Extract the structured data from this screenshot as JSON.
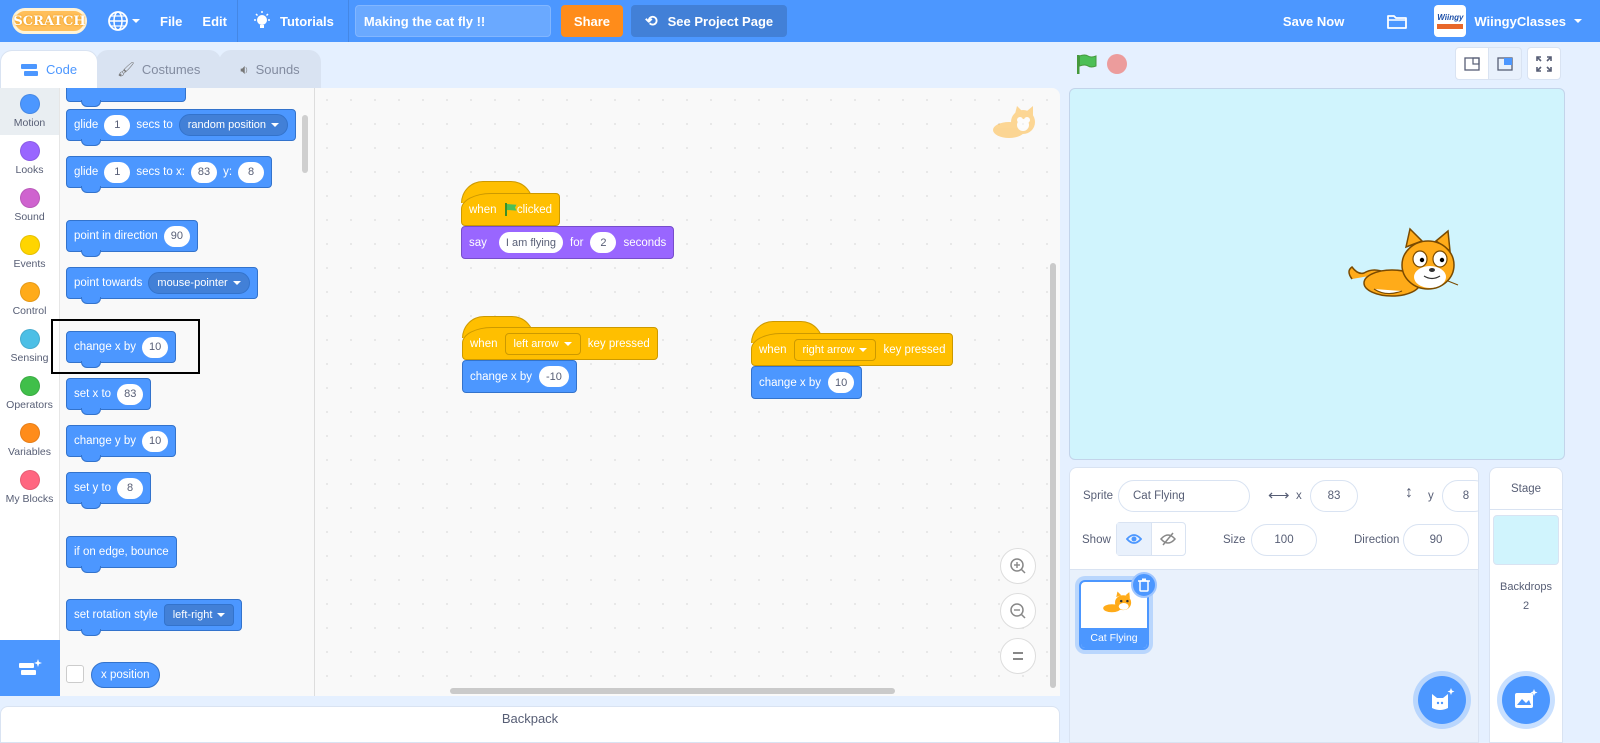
{
  "menubar": {
    "logo": "SCRATCH",
    "file": "File",
    "edit": "Edit",
    "tutorials": "Tutorials",
    "project_title": "Making the cat fly !!",
    "share": "Share",
    "see_project_page": "See Project Page",
    "save_now": "Save Now",
    "username": "WiingyClasses",
    "avatar_text": "Wiingy"
  },
  "tabs": [
    {
      "label": "Code",
      "active": true
    },
    {
      "label": "Costumes",
      "active": false
    },
    {
      "label": "Sounds",
      "active": false
    }
  ],
  "categories": [
    {
      "label": "Motion",
      "color": "#4c97ff"
    },
    {
      "label": "Looks",
      "color": "#9966ff"
    },
    {
      "label": "Sound",
      "color": "#cf63cf"
    },
    {
      "label": "Events",
      "color": "#ffbf00"
    },
    {
      "label": "Control",
      "color": "#ffab19"
    },
    {
      "label": "Sensing",
      "color": "#5cb1d6"
    },
    {
      "label": "Operators",
      "color": "#59c059"
    },
    {
      "label": "Variables",
      "color": "#ff8c1a"
    },
    {
      "label": "My Blocks",
      "color": "#ff6680"
    }
  ],
  "palette": {
    "glide_random": {
      "t1": "glide",
      "v1": "1",
      "t2": "secs to",
      "dd": "random position"
    },
    "glide_xy": {
      "t1": "glide",
      "v1": "1",
      "t2": "secs to x:",
      "x": "83",
      "t3": "y:",
      "y": "8"
    },
    "point_direction": {
      "t1": "point in direction",
      "v": "90"
    },
    "point_towards": {
      "t1": "point towards",
      "dd": "mouse-pointer"
    },
    "change_x": {
      "t1": "change x by",
      "v": "10"
    },
    "set_x": {
      "t1": "set x to",
      "v": "83"
    },
    "change_y": {
      "t1": "change y by",
      "v": "10"
    },
    "set_y": {
      "t1": "set y to",
      "v": "8"
    },
    "bounce": {
      "t1": "if on edge, bounce"
    },
    "rotation": {
      "t1": "set rotation style",
      "dd": "left-right"
    },
    "x_position": "x position"
  },
  "scripts": {
    "flag_script": {
      "hat": {
        "when": "when",
        "clicked": "clicked"
      },
      "say": {
        "t1": "say",
        "text": "I am flying",
        "t2": "for",
        "secs": "2",
        "t3": "seconds"
      }
    },
    "left_script": {
      "hat": {
        "when": "when",
        "key": "left arrow",
        "pressed": "key pressed"
      },
      "move": {
        "t1": "change x by",
        "v": "-10"
      }
    },
    "right_script": {
      "hat": {
        "when": "when",
        "key": "right arrow",
        "pressed": "key pressed"
      },
      "move": {
        "t1": "change x by",
        "v": "10"
      }
    }
  },
  "backpack": "Backpack",
  "sprite_info": {
    "sprite_label": "Sprite",
    "sprite_name": "Cat Flying",
    "x_label": "x",
    "x": "83",
    "y_label": "y",
    "y": "8",
    "show_label": "Show",
    "size_label": "Size",
    "size": "100",
    "direction_label": "Direction",
    "direction": "90"
  },
  "sprites": [
    {
      "name": "Cat Flying",
      "selected": true
    }
  ],
  "stage_pane": {
    "title": "Stage",
    "backdrops_label": "Backdrops",
    "backdrops_count": "2"
  }
}
